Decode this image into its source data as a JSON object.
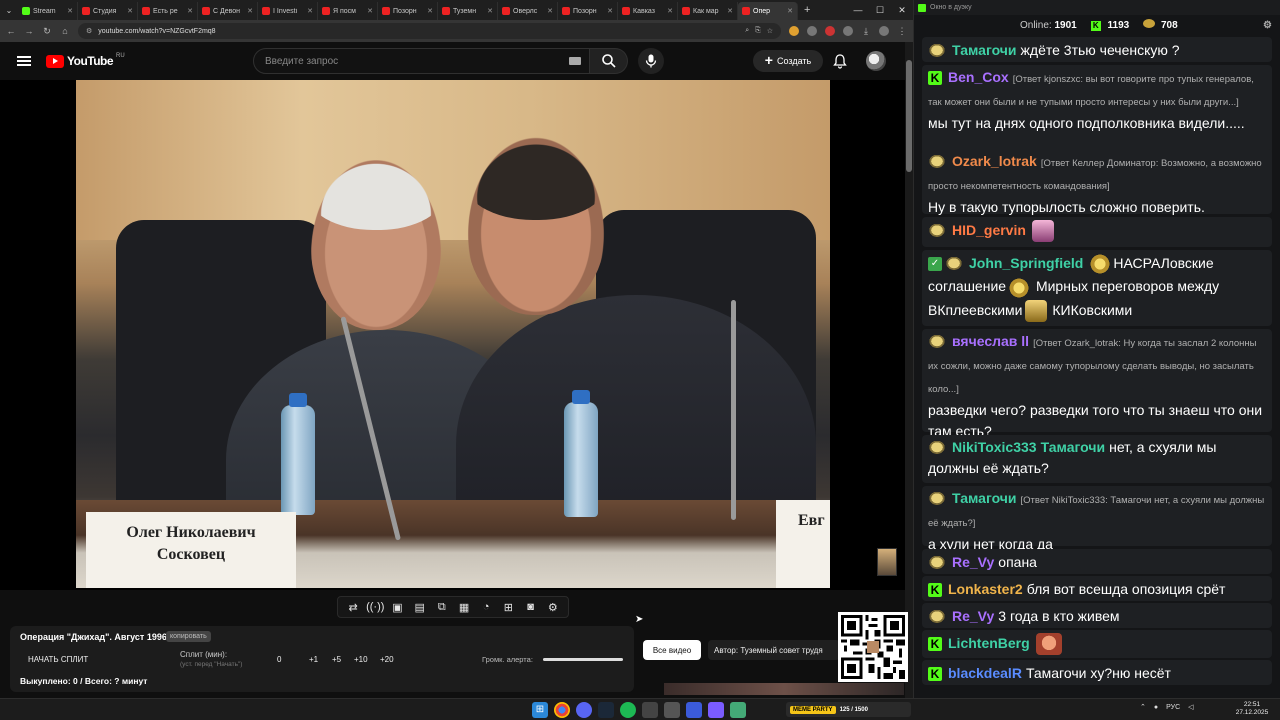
{
  "browser": {
    "tabs": [
      {
        "label": "Stream",
        "fav": "kick"
      },
      {
        "label": "Студия",
        "fav": "yt"
      },
      {
        "label": "Есть ре",
        "fav": "yt"
      },
      {
        "label": "С Девон",
        "fav": "yt"
      },
      {
        "label": "I Investi",
        "fav": "yt"
      },
      {
        "label": "Я посм",
        "fav": "yt"
      },
      {
        "label": "Позорн",
        "fav": "yt"
      },
      {
        "label": "Туземн",
        "fav": "yt"
      },
      {
        "label": "Оверлс",
        "fav": "yt"
      },
      {
        "label": "Позорн",
        "fav": "yt"
      },
      {
        "label": "Кавказ",
        "fav": "yt"
      },
      {
        "label": "Как мар",
        "fav": "yt"
      },
      {
        "label": "Опер",
        "fav": "yt",
        "active": true
      }
    ],
    "url": "youtube.com/watch?v=NZGcvtF2mq8"
  },
  "youtube": {
    "logo_text": "YouTube",
    "region": "RU",
    "search_placeholder": "Введите запрос",
    "create_label": "Создать"
  },
  "video": {
    "nameplate_left_line1": "Олег Николаевич",
    "nameplate_left_line2": "Сосковец",
    "nameplate_right": "Евг"
  },
  "toolbar_icons": [
    "repeat-icon",
    "broadcast-icon",
    "video-settings-icon",
    "clapper-icon",
    "picture-in-picture-icon",
    "layout-icon",
    "speed-icon",
    "add-timer-icon",
    "camera-icon",
    "gear-icon"
  ],
  "split_panel": {
    "title": "Операция \"Джихад\". Август 1996.",
    "badge": "копировать",
    "start_label": "НАЧАТЬ СПЛИТ",
    "split_label": "Сплит (мин):",
    "split_hint": "(уст. перед \"Начать\")",
    "steps": [
      "0",
      "+1",
      "+5",
      "+10",
      "+20"
    ],
    "volume_label": "Громк. алерта:",
    "sold": "Выкуплено: 0 / Всего: ? минут"
  },
  "all_videos_label": "Все видео",
  "author": "Автор: Туземный совет трудя",
  "chat": {
    "window_title": "Окно в дуэку",
    "online_label": "Online:",
    "online_value": "1901",
    "kick_count": "1193",
    "coin_count": "708",
    "messages": [
      {
        "badge": "ava",
        "user": "Тамагочи",
        "color": "#3fd1a6",
        "text": "ждёте 3тью чеченскую ?"
      },
      {
        "badge": "kick",
        "user": "Ben_Cox",
        "color": "#a970ff",
        "reply": "[Ответ kjonszxc: вы вот говорите про тупых генералов, так может они были и не тупыми просто интересы у них были други...]",
        "text": "мы тут на днях одного подполковника видели....."
      },
      {
        "badge": "ava",
        "user": "Ozark_lotrak",
        "color": "#f08a4b",
        "reply": "[Ответ Келлер Доминатор: Возможно, а возможно просто некомпетентность командования]",
        "text": "Ну в такую тупорылость сложно поверить."
      },
      {
        "badge": "ava",
        "user": "HID_gervin",
        "color": "#ff7a45",
        "text": ""
      },
      {
        "badge": "ava",
        "user": "John_Springfield",
        "color": "#3fd1a6",
        "text1": "НАСРАЛовские",
        "text2": "соглашение",
        "text3": "Мирных переговоров между",
        "text4": "ВКплеевскими",
        "text5": "КИКовскими"
      },
      {
        "badge": "ava",
        "user": "вячеслав ll",
        "color": "#a970ff",
        "reply": "[Ответ Ozark_lotrak: Ну когда ты заслал 2 колонны их сожли, можно даже самому тупорылому сделать выводы, но засылать коло...]",
        "text": "разведки чего? разведки того что ты знаеш что они там есть?"
      },
      {
        "badge": "ava",
        "user": "NikiToxic333",
        "color": "#3fd1a6",
        "mention": "Тамагочи",
        "text": "нет, а схуяли мы должны её ждать?"
      },
      {
        "badge": "ava",
        "user": "Тамагочи",
        "color": "#3fd1a6",
        "reply": "[Ответ NikiToxic333: Тамагочи нет, а схуяли мы должны её ждать?]",
        "text": "а хули нет когда да"
      },
      {
        "badge": "ava",
        "user": "Re_Vy",
        "color": "#a970ff",
        "text": "опана"
      },
      {
        "badge": "kick",
        "user": "Lonkaster2",
        "color": "#f0b44b",
        "text": "бля вот всешда опозиция срёт"
      },
      {
        "badge": "ava",
        "user": "Re_Vy",
        "color": "#a970ff",
        "text": "3 года в кто живем"
      },
      {
        "badge": "kick",
        "user": "LichtenBerg",
        "color": "#3fd1a6",
        "text": ""
      },
      {
        "badge": "kick",
        "user": "blackdealR",
        "color": "#5a8cff",
        "text": "Тамагочи ху?ню несёт"
      }
    ]
  },
  "taskbar": {
    "widget_label": "MEME PARTY",
    "widget_count": "125 / 1500",
    "lang": "РУС",
    "time": "22:51",
    "date": "27.12.2025"
  }
}
